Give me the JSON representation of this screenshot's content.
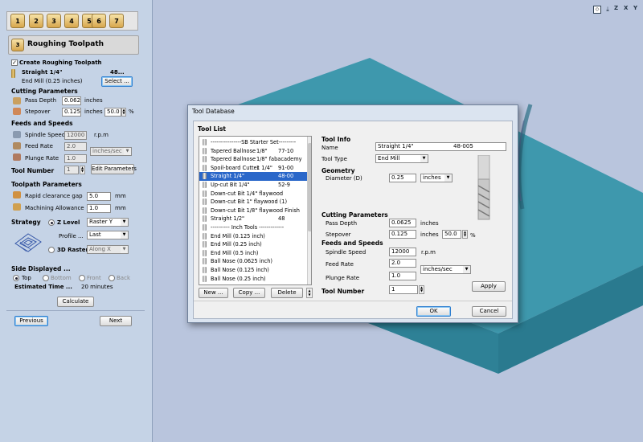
{
  "toolbar": {
    "steps": [
      "1",
      "2",
      "3",
      "4",
      "5",
      "6",
      "7"
    ]
  },
  "panel": {
    "title_badge": "3",
    "title": "Roughing Toolpath",
    "create_label": "Create Roughing Toolpath",
    "create_checked": true,
    "tool_name": "Straight 1/4\"",
    "tool_code": "48...",
    "tool_desc": "End Mill (0.25 inches)",
    "select_button": "Select ...",
    "cutting_header": "Cutting Parameters",
    "pass_depth_label": "Pass Depth",
    "pass_depth_value": "0.0625",
    "pass_depth_unit": "inches",
    "stepover_label": "Stepover",
    "stepover_value": "0.125",
    "stepover_unit": "inches",
    "stepover_pct": "50.0",
    "pct_sign": "%",
    "feeds_header": "Feeds and Speeds",
    "spindle_label": "Spindle Speed",
    "spindle_value": "12000",
    "spindle_unit": "r.p.m",
    "feed_label": "Feed Rate",
    "feed_value": "2.0",
    "feed_unit": "inches/sec",
    "plunge_label": "Plunge Rate",
    "plunge_value": "1.0",
    "tool_number_label": "Tool Number",
    "tool_number_value": "1",
    "edit_params_button": "Edit Parameters",
    "toolpath_header": "Toolpath Parameters",
    "rapid_label": "Rapid clearance gap",
    "rapid_value": "5.0",
    "rapid_unit": "mm",
    "allowance_label": "Machining Allowance",
    "allowance_value": "1.0",
    "allowance_unit": "mm",
    "strategy_label": "Strategy",
    "zlevel_label": "Z Level",
    "zlevel_option": "Raster Y",
    "profile_label": "Profile ...",
    "profile_option": "Last",
    "raster3d_label": "3D Raster",
    "raster3d_option": "Along X",
    "side_header": "Side Displayed ...",
    "side_options": [
      "Top",
      "Bottom",
      "Front",
      "Back"
    ],
    "side_selected": "Top",
    "estimated_label": "Estimated Time ...",
    "estimated_value": "20 minutes",
    "calculate_button": "Calculate",
    "previous_button": "Previous",
    "next_button": "Next"
  },
  "view": {
    "icons": [
      "view-iso-icon",
      "view-down-icon",
      "view-z-icon",
      "view-x-icon",
      "view-y-icon"
    ],
    "axis_labels": [
      "Z",
      "X",
      "Y"
    ],
    "model_color": "#3a90a6",
    "model_top_color": "#3f9aae",
    "model_side_color": "#2d7f94"
  },
  "dialog": {
    "title": "Tool Database",
    "tool_list_header": "Tool List",
    "tools": [
      {
        "name": "----------------SB Starter Set---------",
        "c2": "",
        "c3": ""
      },
      {
        "name": "Tapered Ballnose",
        "c2": "1/8\"",
        "c3": "77-10"
      },
      {
        "name": "Tapered Ballnose",
        "c2": "1/8\" fabacademy",
        "c3": ""
      },
      {
        "name": "Spoil-board Cutter",
        "c2": "1 1/4\"",
        "c3": "91-00"
      },
      {
        "name": "Straight 1/4\"",
        "c2": "",
        "c3": "48-00"
      },
      {
        "name": "Up-cut Bit 1/4\"",
        "c2": "",
        "c3": "52-9"
      },
      {
        "name": "Down-cut Bit 1/4\" flaywood",
        "c2": "",
        "c3": ""
      },
      {
        "name": "Down-cut Bit 1\" flaywood (1)",
        "c2": "",
        "c3": ""
      },
      {
        "name": "Down-cut Bit 1/8\" flaywood Finish",
        "c2": "",
        "c3": ""
      },
      {
        "name": "Straight 1/2\"",
        "c2": "",
        "c3": "48"
      },
      {
        "name": "---------- Inch Tools -------------",
        "c2": "",
        "c3": ""
      },
      {
        "name": "End Mill (0.125 inch)",
        "c2": "",
        "c3": ""
      },
      {
        "name": "End Mill (0.25 inch)",
        "c2": "",
        "c3": ""
      },
      {
        "name": "End Mill (0.5 inch)",
        "c2": "",
        "c3": ""
      },
      {
        "name": "Ball Nose (0.0625 inch)",
        "c2": "",
        "c3": ""
      },
      {
        "name": "Ball Nose (0.125 inch)",
        "c2": "",
        "c3": ""
      },
      {
        "name": "Ball Nose (0.25 inch)",
        "c2": "",
        "c3": ""
      }
    ],
    "selected_index": 4,
    "new_button": "New ...",
    "copy_button": "Copy ...",
    "delete_button": "Delete",
    "tool_info_header": "Tool Info",
    "name_label": "Name",
    "name_value": "Straight 1/4\"",
    "name_code": "48-005",
    "tool_type_label": "Tool Type",
    "tool_type_value": "End Mill",
    "geometry_header": "Geometry",
    "diameter_label": "Diameter (D)",
    "diameter_value": "0.25",
    "diameter_unit": "inches",
    "cutting_header": "Cutting Parameters",
    "pass_depth_label": "Pass Depth",
    "pass_depth_value": "0.0625",
    "pass_depth_unit": "inches",
    "stepover_label": "Stepover",
    "stepover_value": "0.125",
    "stepover_unit": "inches",
    "stepover_pct": "50.0",
    "pct_sign": "%",
    "feeds_header": "Feeds and Speeds",
    "spindle_label": "Spindle Speed",
    "spindle_value": "12000",
    "spindle_unit": "r.p.m",
    "feed_label": "Feed Rate",
    "feed_value": "2.0",
    "feed_unit": "inches/sec",
    "plunge_label": "Plunge Rate",
    "plunge_value": "1.0",
    "tool_number_label": "Tool Number",
    "tool_number_value": "1",
    "apply_button": "Apply",
    "ok_button": "OK",
    "cancel_button": "Cancel"
  }
}
